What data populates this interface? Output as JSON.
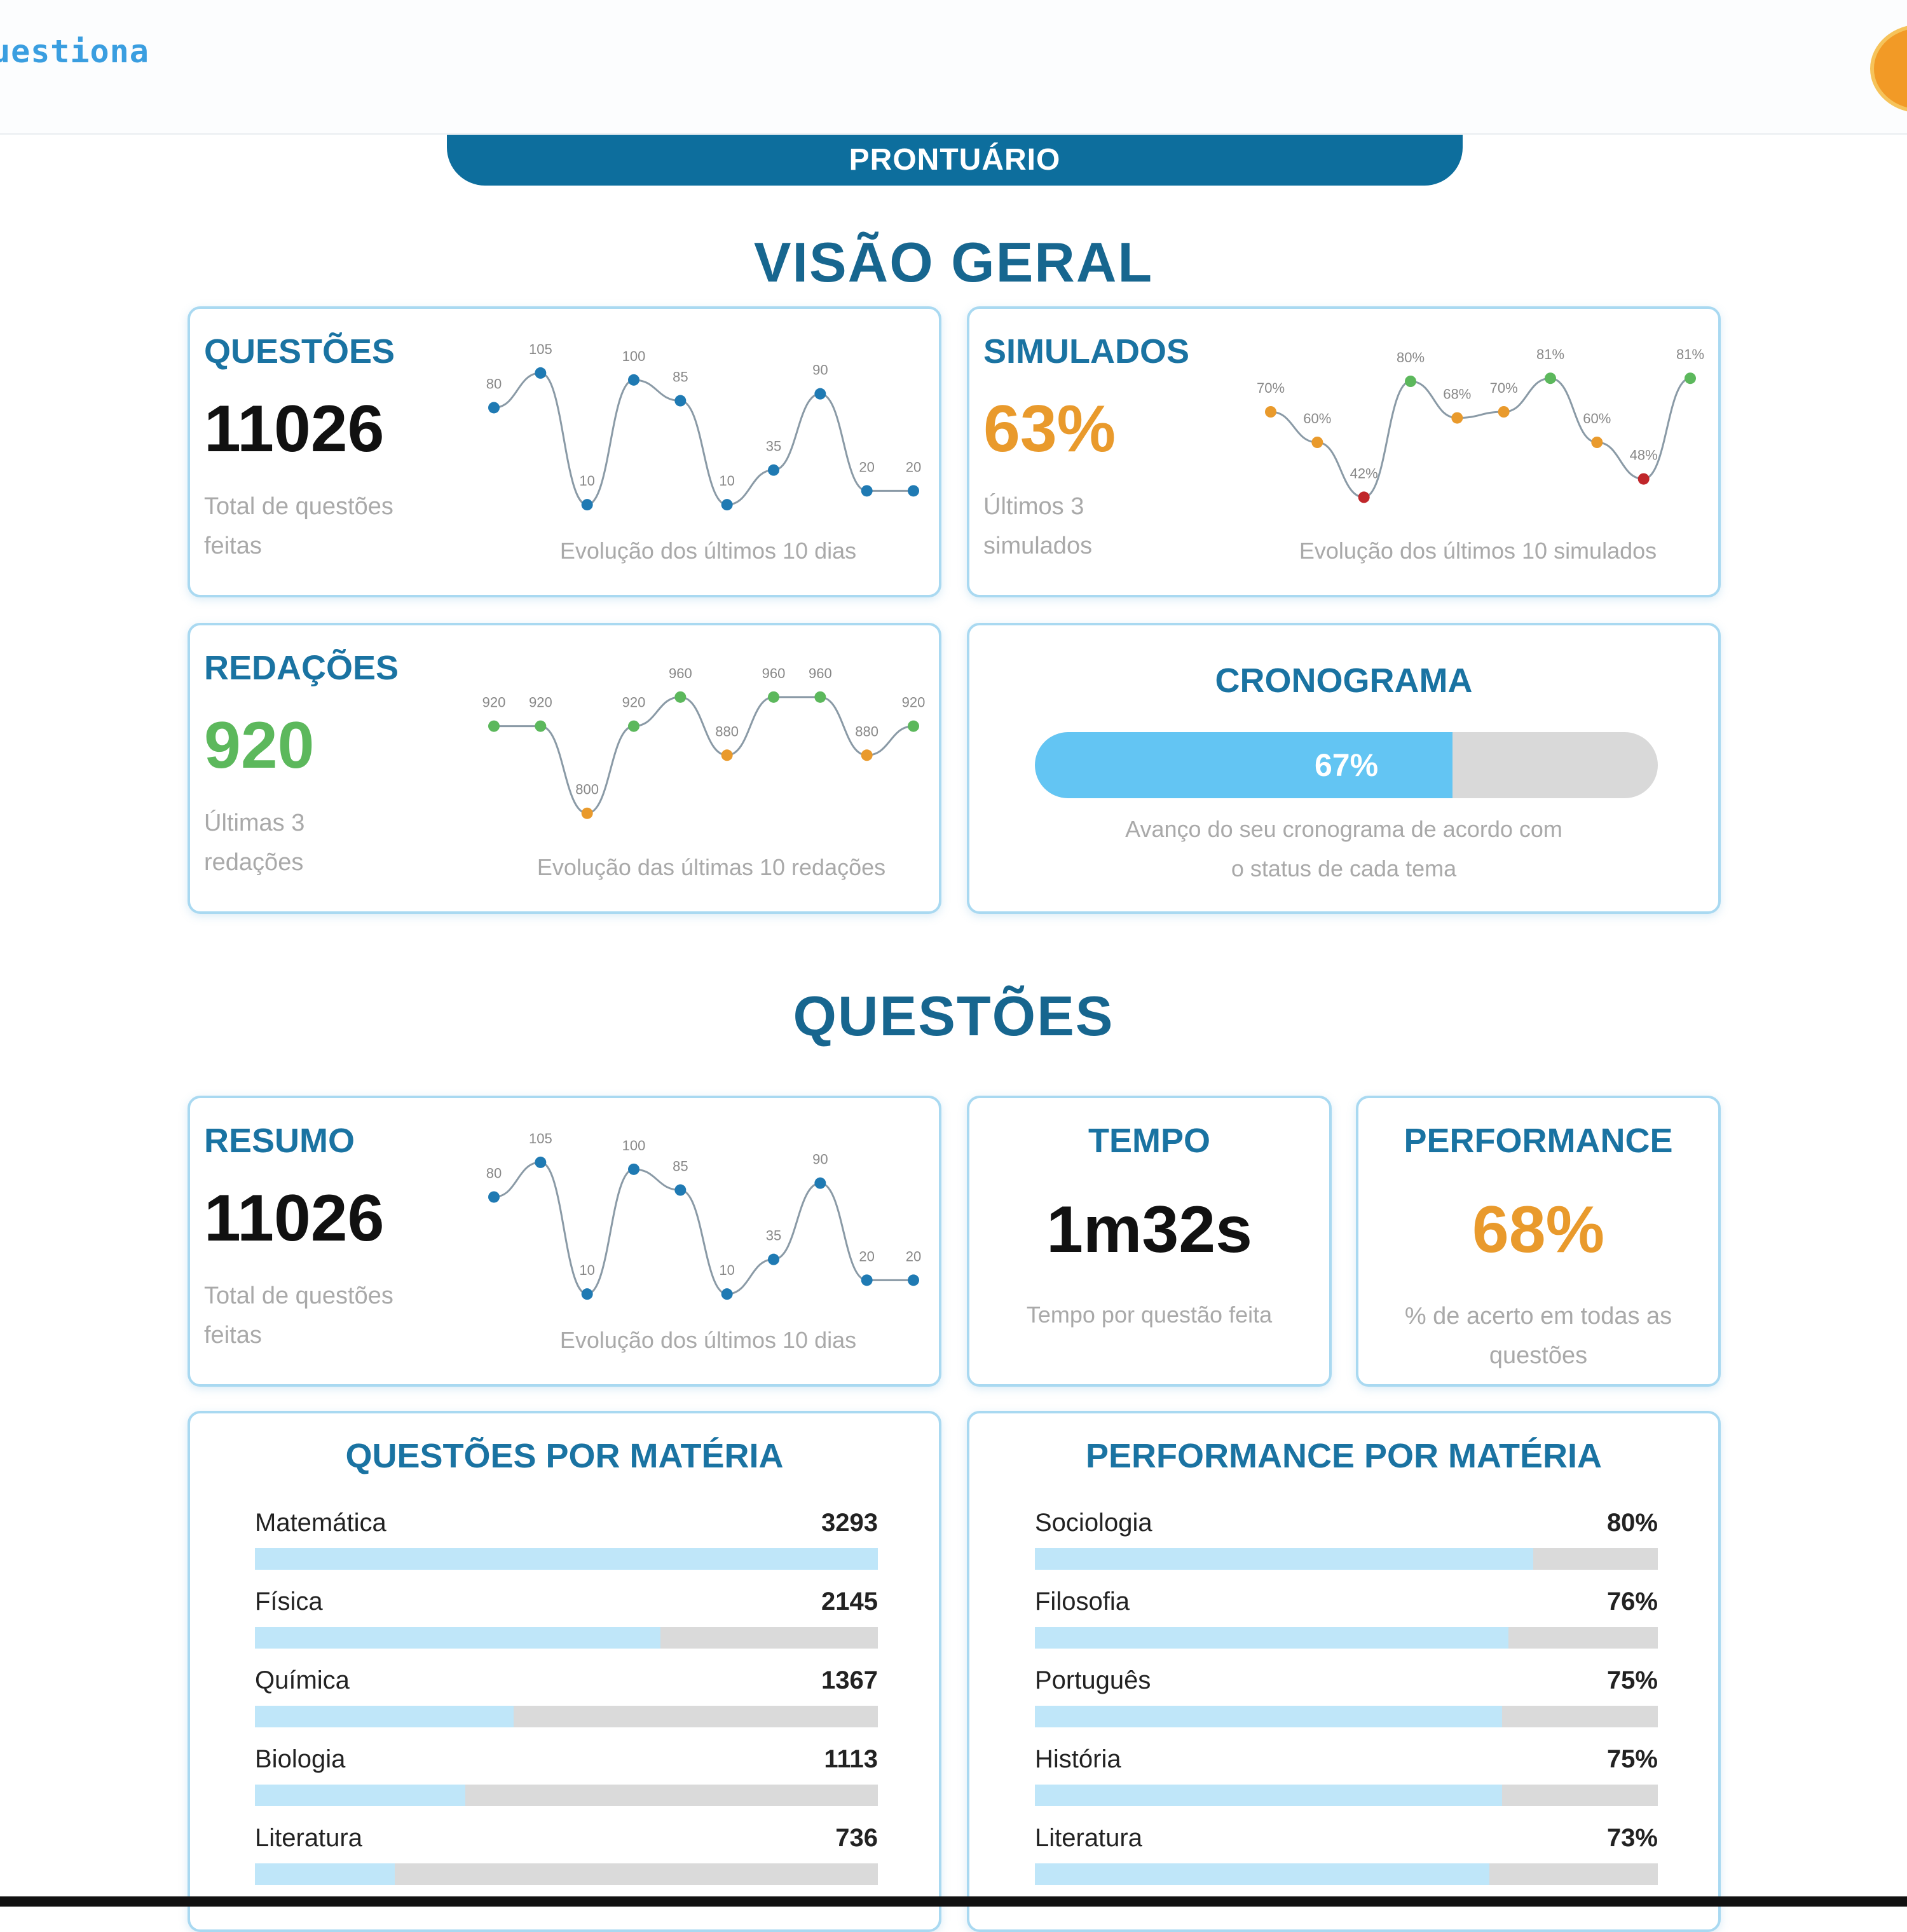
{
  "app": {
    "logo_text": "uestiona"
  },
  "banner": {
    "label": "PRONTUÁRIO"
  },
  "overview": {
    "title": "VISÃO GERAL",
    "questoes": {
      "title": "QUESTÕES",
      "value": "11026",
      "subtitle": "Total de questões feitas",
      "caption": "Evolução dos últimos 10 dias",
      "points": [
        {
          "value": 80,
          "label": "80",
          "color": "#1f7ab3"
        },
        {
          "value": 105,
          "label": "105",
          "color": "#1f7ab3"
        },
        {
          "value": 10,
          "label": "10",
          "color": "#1f7ab3"
        },
        {
          "value": 100,
          "label": "100",
          "color": "#1f7ab3"
        },
        {
          "value": 85,
          "label": "85",
          "color": "#1f7ab3"
        },
        {
          "value": 10,
          "label": "10",
          "color": "#1f7ab3"
        },
        {
          "value": 35,
          "label": "35",
          "color": "#1f7ab3"
        },
        {
          "value": 90,
          "label": "90",
          "color": "#1f7ab3"
        },
        {
          "value": 20,
          "label": "20",
          "color": "#1f7ab3"
        },
        {
          "value": 20,
          "label": "20",
          "color": "#1f7ab3"
        }
      ]
    },
    "simulados": {
      "title": "SIMULADOS",
      "value": "63%",
      "subtitle": "Últimos 3 simulados",
      "caption": "Evolução dos últimos 10 simulados",
      "points": [
        {
          "value": 70,
          "label": "70%",
          "color": "#e99a2c"
        },
        {
          "value": 60,
          "label": "60%",
          "color": "#e99a2c"
        },
        {
          "value": 42,
          "label": "42%",
          "color": "#c0262a"
        },
        {
          "value": 80,
          "label": "80%",
          "color": "#5cb85c"
        },
        {
          "value": 68,
          "label": "68%",
          "color": "#e99a2c"
        },
        {
          "value": 70,
          "label": "70%",
          "color": "#e99a2c"
        },
        {
          "value": 81,
          "label": "81%",
          "color": "#5cb85c"
        },
        {
          "value": 60,
          "label": "60%",
          "color": "#e99a2c"
        },
        {
          "value": 48,
          "label": "48%",
          "color": "#c0262a"
        },
        {
          "value": 81,
          "label": "81%",
          "color": "#5cb85c"
        }
      ]
    },
    "redacoes": {
      "title": "REDAÇÕES",
      "value": "920",
      "subtitle": "Últimas 3 redações",
      "caption": "Evolução das últimas 10 redações",
      "points": [
        {
          "value": 920,
          "label": "920",
          "color": "#5cb85c"
        },
        {
          "value": 920,
          "label": "920",
          "color": "#5cb85c"
        },
        {
          "value": 800,
          "label": "800",
          "color": "#e99a2c"
        },
        {
          "value": 920,
          "label": "920",
          "color": "#5cb85c"
        },
        {
          "value": 960,
          "label": "960",
          "color": "#5cb85c"
        },
        {
          "value": 880,
          "label": "880",
          "color": "#e99a2c"
        },
        {
          "value": 960,
          "label": "960",
          "color": "#5cb85c"
        },
        {
          "value": 960,
          "label": "960",
          "color": "#5cb85c"
        },
        {
          "value": 880,
          "label": "880",
          "color": "#e99a2c"
        },
        {
          "value": 920,
          "label": "920",
          "color": "#5cb85c"
        }
      ]
    },
    "cronograma": {
      "title": "CRONOGRAMA",
      "progress": 0.67,
      "progress_label": "67%",
      "caption_line1": "Avanço do seu cronograma de acordo com",
      "caption_line2": "o status de cada tema"
    }
  },
  "questoes_section": {
    "title": "QUESTÕES",
    "resumo": {
      "title": "RESUMO",
      "value": "11026",
      "subtitle": "Total de questões feitas",
      "caption": "Evolução dos últimos 10 dias",
      "points": [
        {
          "value": 80,
          "label": "80",
          "color": "#1f7ab3"
        },
        {
          "value": 105,
          "label": "105",
          "color": "#1f7ab3"
        },
        {
          "value": 10,
          "label": "10",
          "color": "#1f7ab3"
        },
        {
          "value": 100,
          "label": "100",
          "color": "#1f7ab3"
        },
        {
          "value": 85,
          "label": "85",
          "color": "#1f7ab3"
        },
        {
          "value": 10,
          "label": "10",
          "color": "#1f7ab3"
        },
        {
          "value": 35,
          "label": "35",
          "color": "#1f7ab3"
        },
        {
          "value": 90,
          "label": "90",
          "color": "#1f7ab3"
        },
        {
          "value": 20,
          "label": "20",
          "color": "#1f7ab3"
        },
        {
          "value": 20,
          "label": "20",
          "color": "#1f7ab3"
        }
      ]
    },
    "tempo": {
      "title": "TEMPO",
      "value": "1m32s",
      "caption": "Tempo por questão feita"
    },
    "performance": {
      "title": "PERFORMANCE",
      "value": "68%",
      "caption": "% de acerto em todas as questões"
    },
    "por_materia": {
      "title": "QUESTÕES POR MATÉRIA",
      "items": [
        {
          "label": "Matemática",
          "value": "3293",
          "fraction": 1.0
        },
        {
          "label": "Física",
          "value": "2145",
          "fraction": 0.651
        },
        {
          "label": "Química",
          "value": "1367",
          "fraction": 0.415
        },
        {
          "label": "Biologia",
          "value": "1113",
          "fraction": 0.338
        },
        {
          "label": "Literatura",
          "value": "736",
          "fraction": 0.224
        }
      ]
    },
    "performance_materia": {
      "title": "PERFORMANCE POR MATÉRIA",
      "items": [
        {
          "label": "Sociologia",
          "value": "80%",
          "fraction": 0.8
        },
        {
          "label": "Filosofia",
          "value": "76%",
          "fraction": 0.76
        },
        {
          "label": "Português",
          "value": "75%",
          "fraction": 0.75
        },
        {
          "label": "História",
          "value": "75%",
          "fraction": 0.75
        },
        {
          "label": "Literatura",
          "value": "73%",
          "fraction": 0.73
        }
      ]
    }
  },
  "colors": {
    "brand": "#0d6e9d",
    "title": "#17668f",
    "simulados_value": "#e99a2c",
    "redacoes_value": "#5cb85c",
    "performance_value": "#e99a2c",
    "progress_fill": "#63c5f3",
    "bar_fill": "#bfe6f9"
  }
}
